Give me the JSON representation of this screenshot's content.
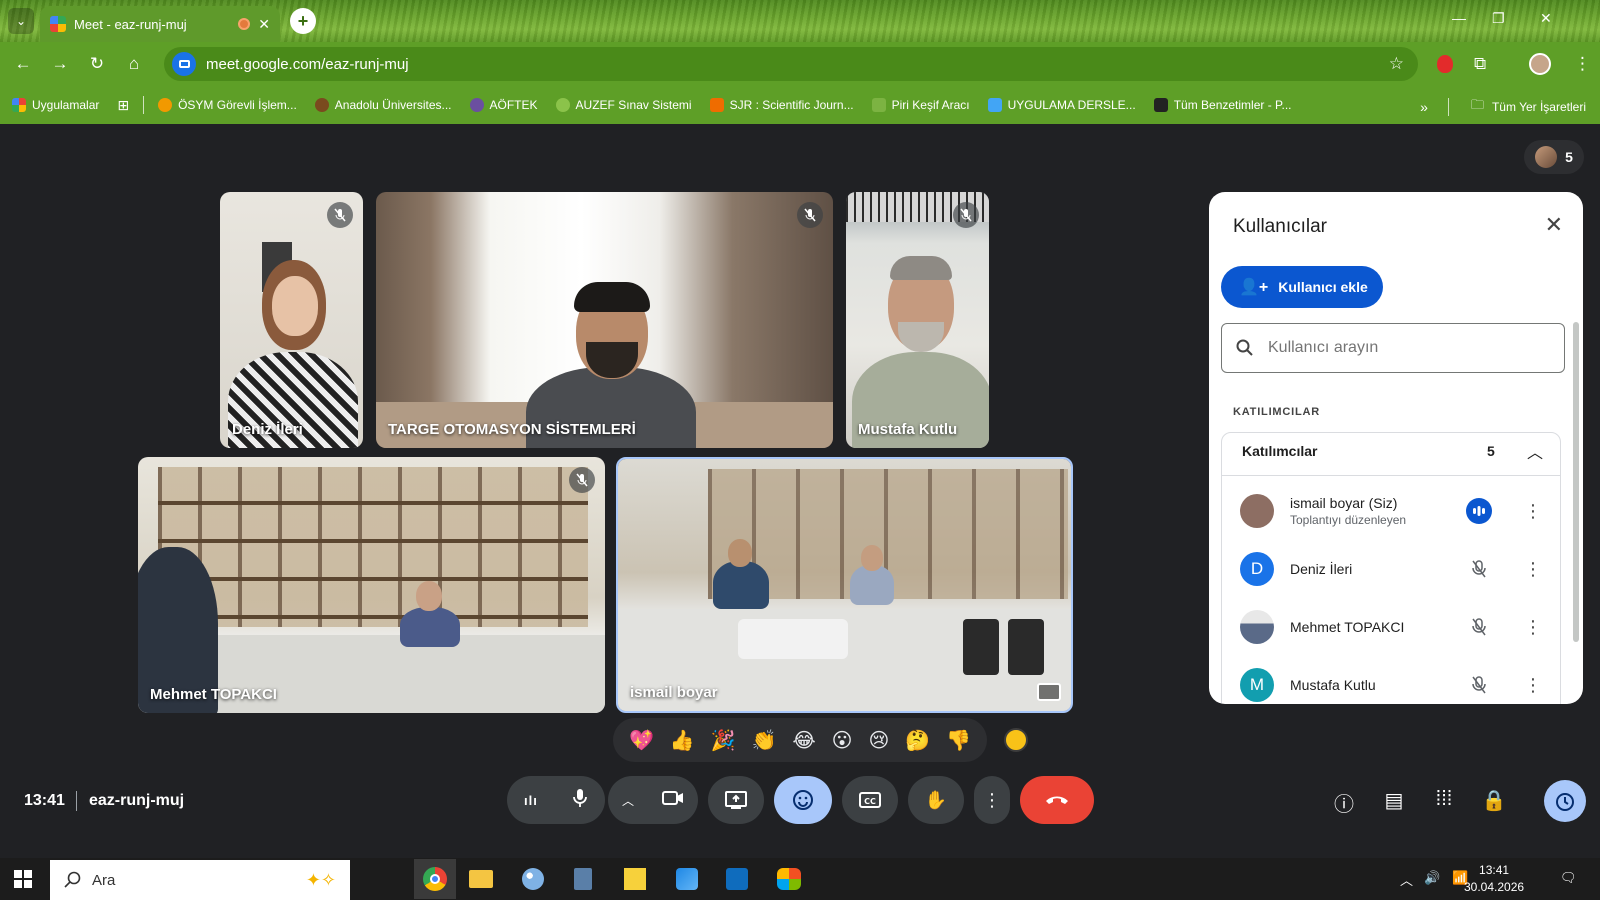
{
  "browser": {
    "tab_title": "Meet - eaz-runj-muj",
    "url": "meet.google.com/eaz-runj-muj",
    "bookmarks": [
      {
        "label": "Uygulamalar",
        "color": "#f4b400"
      },
      {
        "label": "ÖSYM Görevli İşlem...",
        "color": "#f29900"
      },
      {
        "label": "Anadolu Üniversites...",
        "color": "#7a4a1e"
      },
      {
        "label": "AÖFTEK",
        "color": "#6b4fa0"
      },
      {
        "label": "AUZEF Sınav Sistemi",
        "color": "#8bc34a"
      },
      {
        "label": "SJR : Scientific Journ...",
        "color": "#ef6c00"
      },
      {
        "label": "Piri Keşif Aracı",
        "color": "#7cb342"
      },
      {
        "label": "UYGULAMA DERSLE...",
        "color": "#42a5f5"
      },
      {
        "label": "Tüm Benzetimler - P...",
        "color": "#222222"
      }
    ],
    "all_bookmarks": "Tüm Yer İşaretleri"
  },
  "meet": {
    "participant_count": "5",
    "time": "13:41",
    "meeting_code": "eaz-runj-muj",
    "tiles": {
      "t1": "Deniz İleri",
      "t2": "TARGE OTOMASYON SİSTEMLERİ",
      "t3": "Mustafa Kutlu",
      "t4": "Mehmet TOPAKCI",
      "t5": "ismail boyar"
    },
    "reactions": [
      "💖",
      "👍",
      "🎉",
      "👏",
      "😂",
      "😮",
      "😢",
      "🤔",
      "👎"
    ]
  },
  "panel": {
    "title": "Kullanıcılar",
    "add_label": "Kullanıcı ekle",
    "search_placeholder": "Kullanıcı arayın",
    "section_label": "KATILIMCILAR",
    "group_label": "Katılımcılar",
    "group_count": "5",
    "people": [
      {
        "name": "ismail boyar (Siz)",
        "sub": "Toplantıyı düzenleyen",
        "initial": "",
        "color": "#8d6e63"
      },
      {
        "name": "Deniz İleri",
        "sub": "",
        "initial": "D",
        "color": "#1a73e8"
      },
      {
        "name": "Mehmet TOPAKCI",
        "sub": "",
        "initial": "",
        "color": "#9e9e9e"
      },
      {
        "name": "Mustafa Kutlu",
        "sub": "",
        "initial": "M",
        "color": "#129eaf"
      }
    ]
  },
  "taskbar": {
    "search_placeholder": "Ara",
    "time": "13:41",
    "date": "30.04.2026"
  }
}
